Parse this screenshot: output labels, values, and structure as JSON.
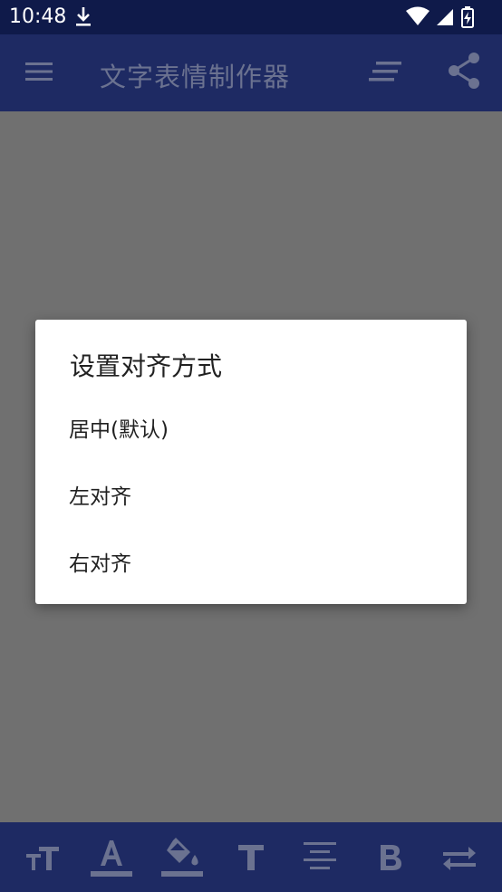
{
  "status_bar": {
    "time": "10:48",
    "icons": [
      "download-icon",
      "wifi-icon",
      "signal-icon",
      "battery-charging-icon"
    ]
  },
  "app_bar": {
    "title": "文字表情制作器",
    "icons": [
      "menu-icon",
      "text-align-icon",
      "share-icon"
    ]
  },
  "dialog": {
    "title": "设置对齐方式",
    "options": [
      {
        "label": "居中(默认)"
      },
      {
        "label": "左对齐"
      },
      {
        "label": "右对齐"
      }
    ]
  },
  "bottom_toolbar": {
    "tools": [
      "text-size-icon",
      "text-color-icon",
      "fill-color-icon",
      "font-icon",
      "align-center-icon",
      "bold-icon",
      "swap-icon"
    ]
  },
  "colors": {
    "status_bar": "#0f1a4a",
    "app_bar": "#1e2a63",
    "scrim": "#707070",
    "icon": "#6b7290"
  }
}
